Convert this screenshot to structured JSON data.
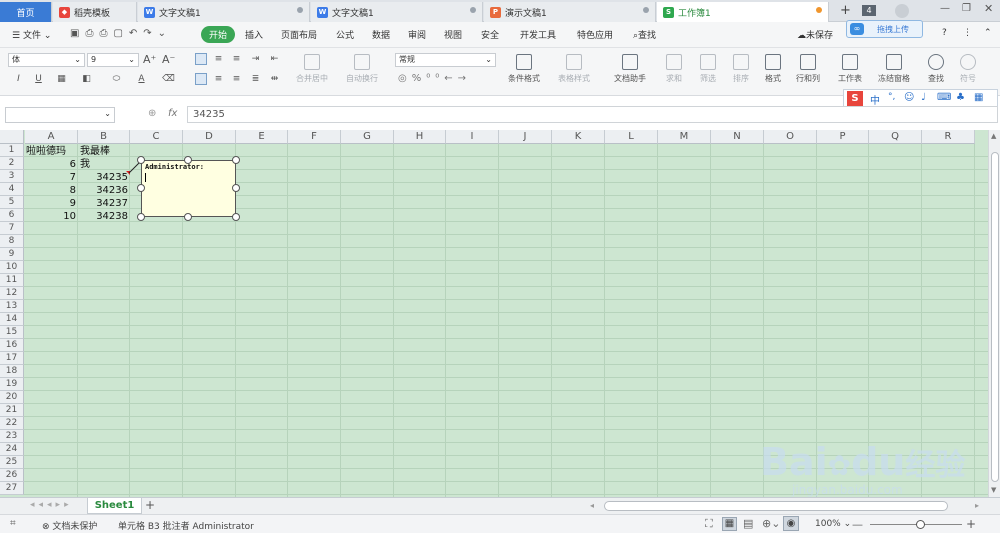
{
  "tabs": [
    {
      "label": "首页"
    },
    {
      "label": "稻壳模板",
      "icon": "docer-icon",
      "color": "#e8453c"
    },
    {
      "label": "文字文稿1",
      "icon": "writer-icon",
      "color": "#3c7be8"
    },
    {
      "label": "文字文稿1",
      "icon": "writer-icon",
      "color": "#3c7be8"
    },
    {
      "label": "演示文稿1",
      "icon": "presentation-icon",
      "color": "#e86a3c"
    },
    {
      "label": "工作簿1",
      "icon": "spreadsheet-icon",
      "color": "#2fa84f"
    }
  ],
  "tab_count": "4",
  "upload_label": "拖拽上传",
  "menu": {
    "file": "文件",
    "items": [
      "开始",
      "插入",
      "页面布局",
      "公式",
      "数据",
      "审阅",
      "视图",
      "安全",
      "开发工具",
      "特色应用"
    ],
    "search": "查找",
    "unsaved": "未保存",
    "help": "?"
  },
  "toolbar": {
    "font": "体",
    "size": "9",
    "format": "常规",
    "merge": "合并居中",
    "wrap": "自动换行",
    "cond_format": "条件格式",
    "table_style": "表格样式",
    "doc_helper": "文档助手",
    "sum": "求和",
    "filter": "筛选",
    "sort": "排序",
    "format_btn": "格式",
    "rows_cols": "行和列",
    "worksheet": "工作表",
    "freeze": "冻结窗格",
    "find": "查找",
    "symbol": "符号"
  },
  "ime": {
    "zh": "中",
    "dot": "°,"
  },
  "formula": {
    "namebox": "",
    "fx": "fx",
    "value": "34235"
  },
  "columns": [
    "A",
    "B",
    "C",
    "D",
    "E",
    "F",
    "G",
    "H",
    "I",
    "J",
    "K",
    "L",
    "M",
    "N",
    "O",
    "P",
    "Q",
    "R"
  ],
  "rows": [
    "1",
    "2",
    "3",
    "4",
    "5",
    "6",
    "7",
    "8",
    "9",
    "10",
    "11",
    "12",
    "13",
    "14",
    "15",
    "16",
    "17",
    "18",
    "19",
    "20",
    "21",
    "22",
    "23",
    "24",
    "25",
    "26",
    "27"
  ],
  "cells": {
    "A1": "啦啦德玛",
    "B1": "我最棒",
    "A2": "6",
    "B2": "我",
    "A3": "7",
    "B3": "34235",
    "A4": "8",
    "B4": "34236",
    "A5": "9",
    "B5": "34237",
    "A6": "10",
    "B6": "34238"
  },
  "comment": {
    "author": "Administrator:"
  },
  "sheet": {
    "name": "Sheet1",
    "add": "+"
  },
  "status": {
    "protect": "文档未保护",
    "cell_info": "单元格 B3 批注者 Administrator",
    "zoom": "100%"
  },
  "watermark": {
    "brand": "Bai",
    "du": "du",
    "cn": "经验",
    "url": "jingyan.baidu.com"
  }
}
